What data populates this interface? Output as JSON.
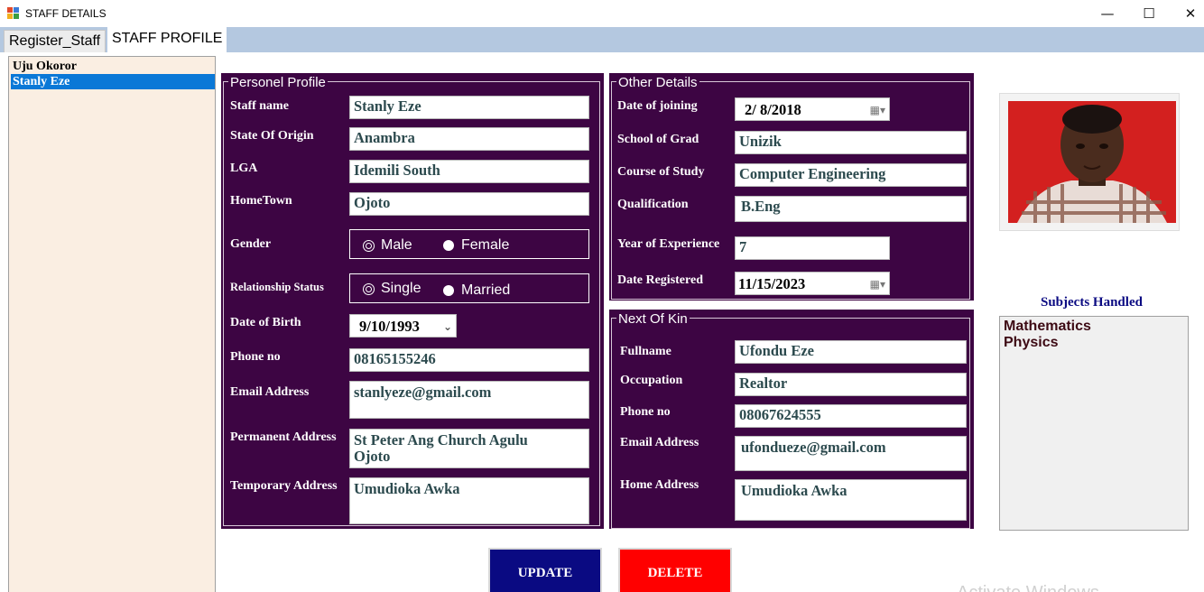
{
  "window": {
    "title": "STAFF DETAILS",
    "minimize_glyph": "—",
    "maximize_glyph": "☐",
    "close_glyph": "✕"
  },
  "tabs": [
    {
      "label": "Register_Staff",
      "active": false
    },
    {
      "label": "STAFF PROFILE",
      "active": true
    }
  ],
  "staff_list": [
    {
      "name": "Uju Okoror",
      "selected": false
    },
    {
      "name": "Stanly Eze",
      "selected": true
    }
  ],
  "personal_profile": {
    "title": "Personel Profile",
    "staff_name_label": "Staff name",
    "staff_name": "Stanly Eze",
    "state_label": "State Of Origin",
    "state": "Anambra",
    "lga_label": "LGA",
    "lga": "Idemili South",
    "hometown_label": "HomeTown",
    "hometown": "Ojoto",
    "gender_label": "Gender",
    "gender_options": [
      "Male",
      "Female"
    ],
    "gender_selected": "Male",
    "relationship_label": "Relationship Status",
    "relationship_options": [
      "Single",
      "Married"
    ],
    "relationship_selected": "Single",
    "dob_label": "Date of Birth",
    "dob": "9/10/1993",
    "phone_label": "Phone no",
    "phone": "08165155246",
    "email_label": "Email Address",
    "email": "stanlyeze@gmail.com",
    "perm_address_label": "Permanent Address",
    "perm_address": "St Peter Ang Church Agulu\nOjoto",
    "temp_address_label": "Temporary Address",
    "temp_address": "Umudioka Awka"
  },
  "other_details": {
    "title": "Other Details",
    "join_label": "Date of joining",
    "join_date": "2/  8/2018",
    "school_label": "School of Grad",
    "school": "Unizik",
    "course_label": "Course of Study",
    "course": "Computer Engineering",
    "qualification_label": "Qualification",
    "qualification": "B.Eng",
    "experience_label": "Year of Experience",
    "experience": "7",
    "registered_label": "Date Registered",
    "registered_date": "11/15/2023"
  },
  "next_of_kin": {
    "title": "Next Of Kin",
    "fullname_label": "Fullname",
    "fullname": "Ufondu Eze",
    "occupation_label": "Occupation",
    "occupation": "Realtor",
    "phone_label": "Phone no",
    "phone": "08067624555",
    "email_label": "Email Address",
    "email": "ufondueze@gmail.com",
    "home_label": "Home Address",
    "home": "Umudioka Awka"
  },
  "subjects": {
    "title": "Subjects Handled",
    "items": [
      "Mathematics",
      "Physics"
    ]
  },
  "buttons": {
    "update": "UPDATE",
    "delete": "DELETE"
  },
  "watermark": "Activate Windows",
  "colors": {
    "panel": "#3d0543",
    "tab_strip": "#b4c8e0",
    "list_bg": "#faeee2",
    "update_btn": "#0a0a82",
    "delete_btn": "#ff0000",
    "selection": "#0a78d7"
  }
}
